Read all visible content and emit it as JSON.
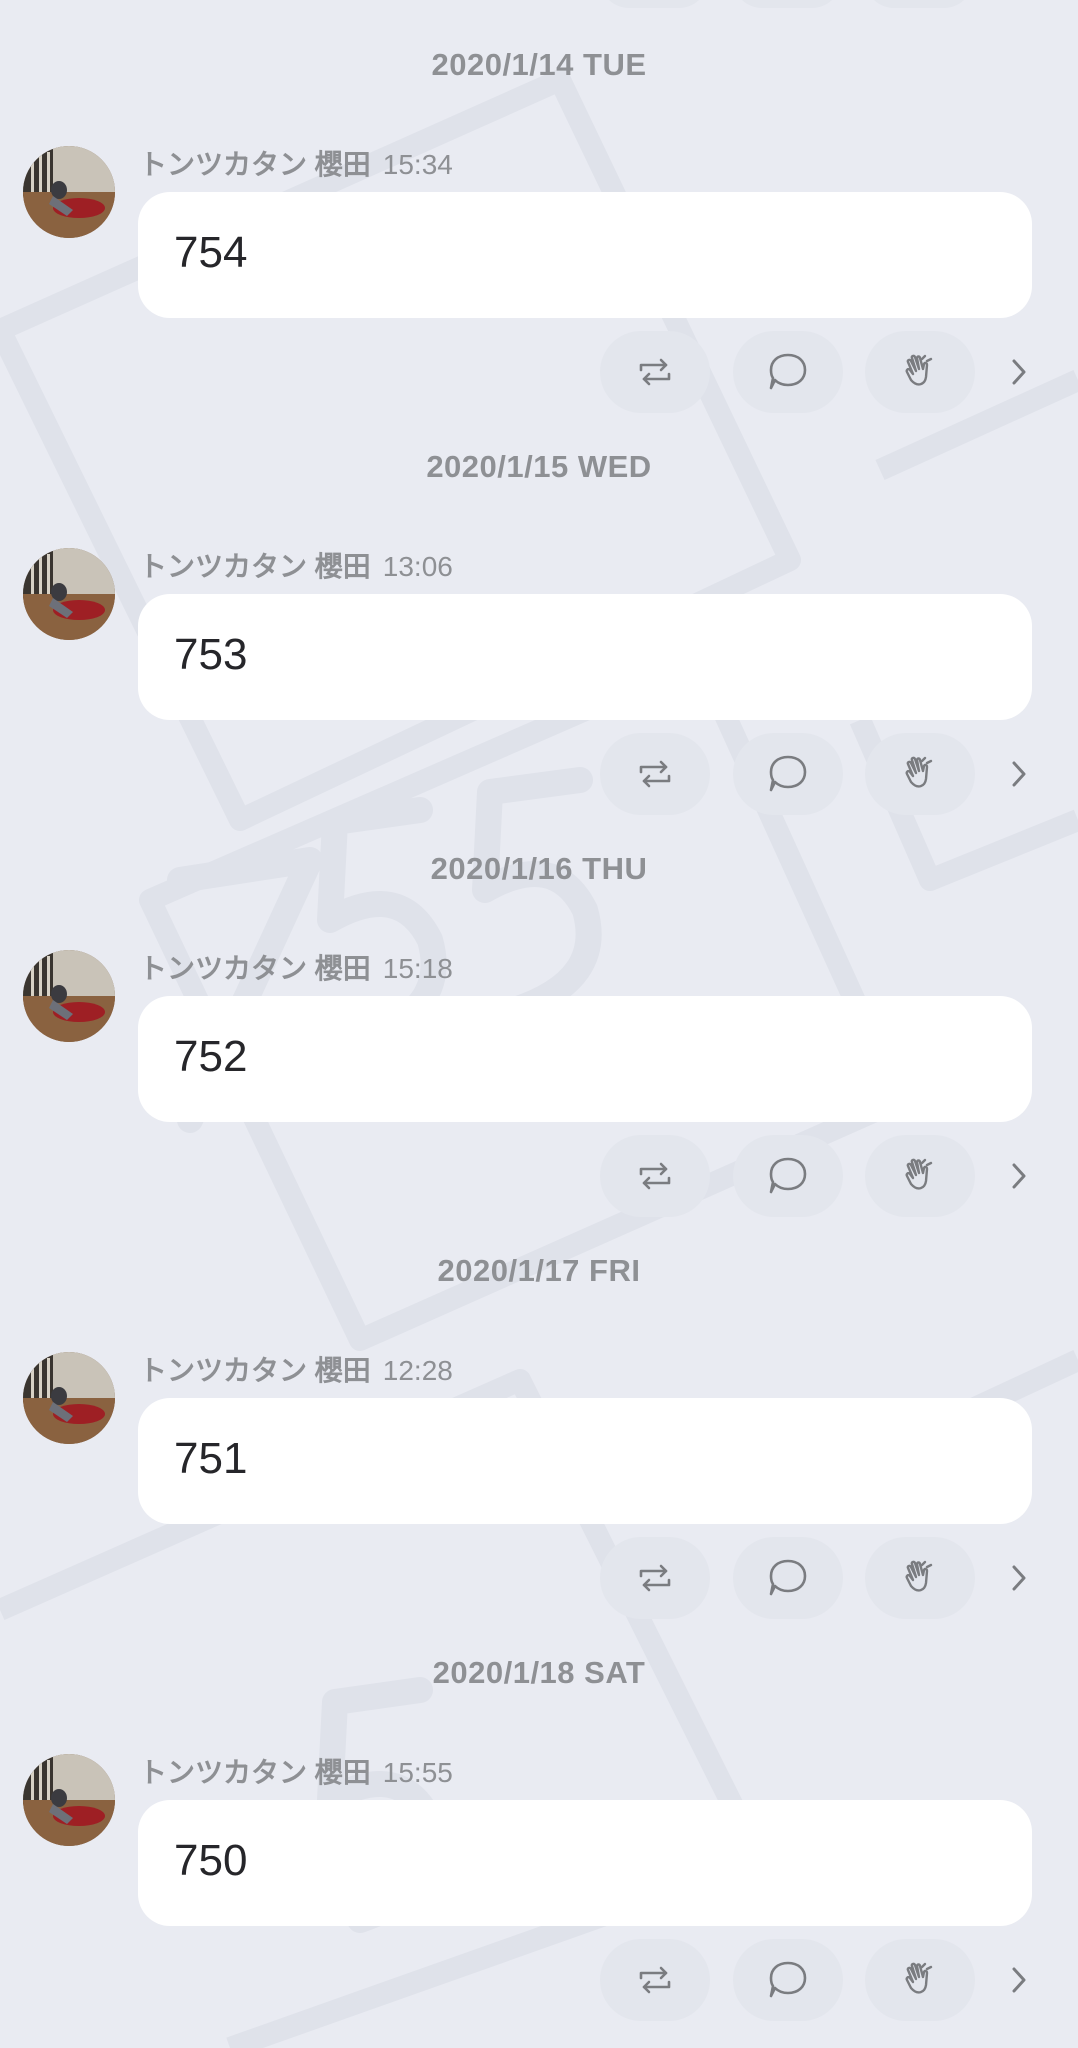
{
  "theme": {
    "background": "#e9ebf2",
    "bubble": "#ffffff",
    "button": "#e3e6ed",
    "meta_text": "#8e9094",
    "message_text": "#26262a",
    "icon": "#7a7c80"
  },
  "icons": {
    "repost": "repost-icon",
    "comment": "comment-icon",
    "clap": "clap-icon",
    "more": "chevron-right-icon"
  },
  "posts": [
    {
      "date": "2020/1/14 TUE",
      "author": "トンツカタン 櫻田",
      "time": "15:34",
      "message": "754"
    },
    {
      "date": "2020/1/15 WED",
      "author": "トンツカタン 櫻田",
      "time": "13:06",
      "message": "753"
    },
    {
      "date": "2020/1/16 THU",
      "author": "トンツカタン 櫻田",
      "time": "15:18",
      "message": "752"
    },
    {
      "date": "2020/1/17 FRI",
      "author": "トンツカタン 櫻田",
      "time": "12:28",
      "message": "751"
    },
    {
      "date": "2020/1/18 SAT",
      "author": "トンツカタン 櫻田",
      "time": "15:55",
      "message": "750"
    }
  ]
}
